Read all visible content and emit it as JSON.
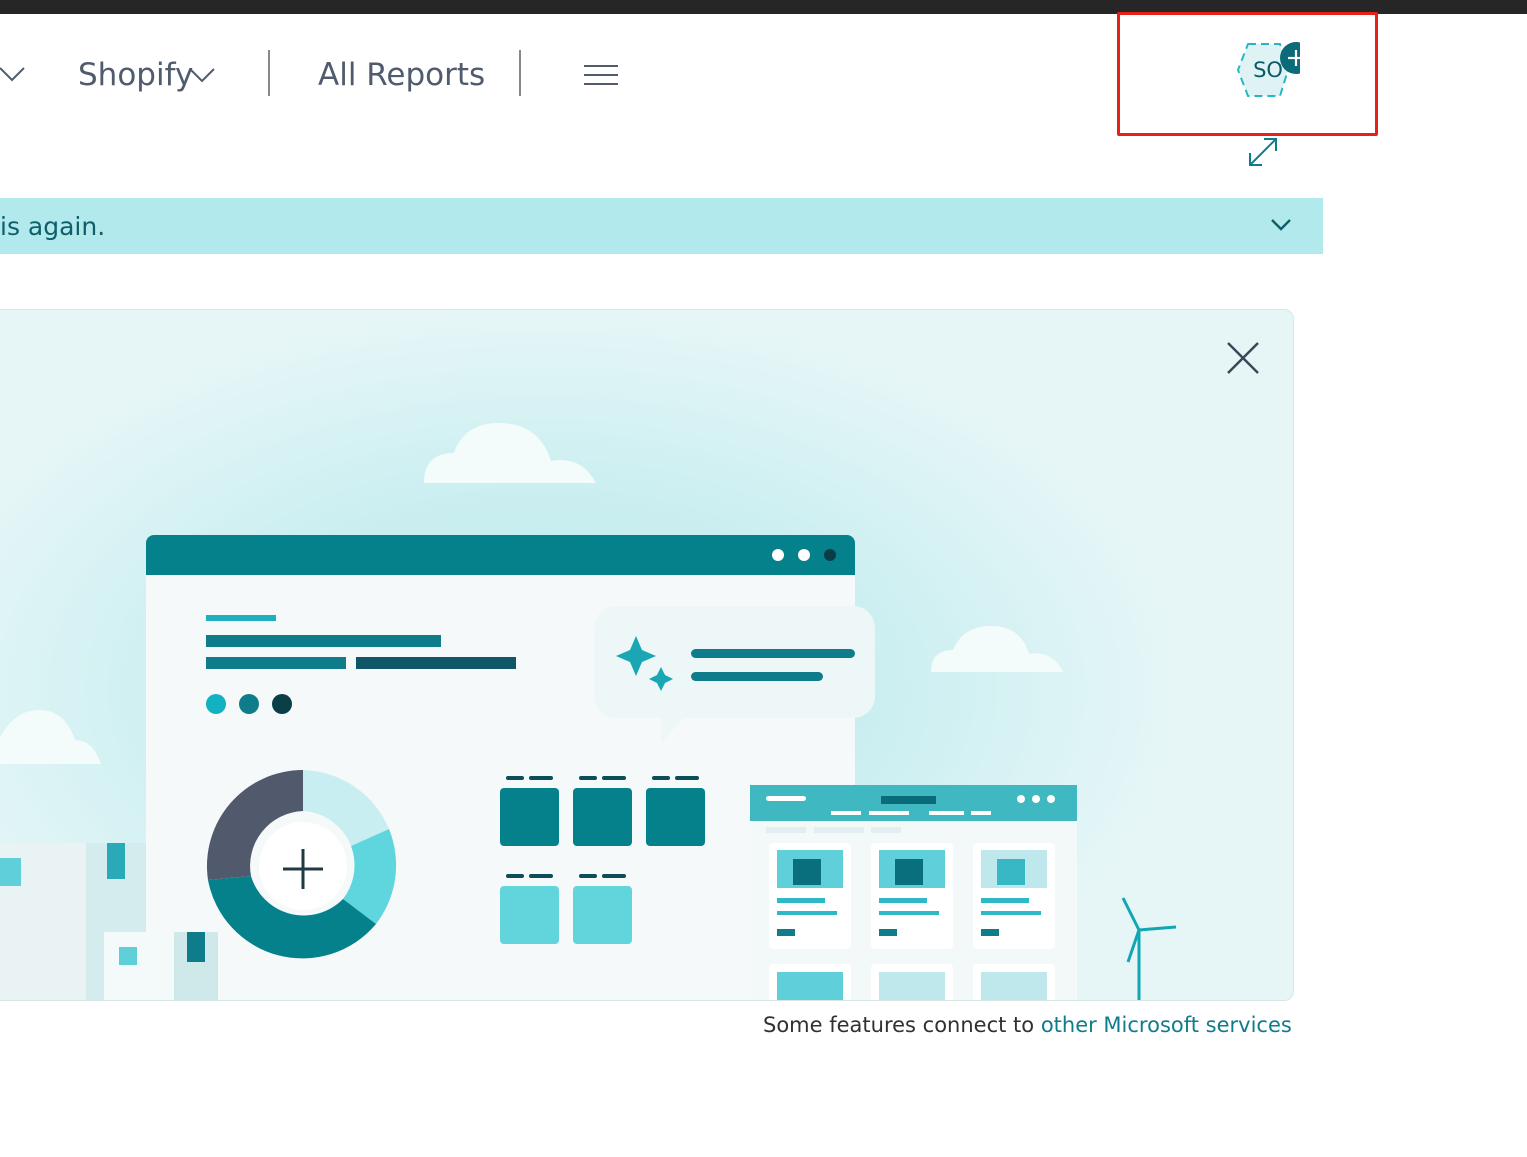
{
  "nav": {
    "shopify_label": "Shopify",
    "reports_label": "All Reports"
  },
  "profile": {
    "avatar_initials": "SO"
  },
  "banner": {
    "text": "is again."
  },
  "footer": {
    "prefix": "Some features connect to ",
    "link_text": "other Microsoft services"
  },
  "colors": {
    "accent": "#008591",
    "banner_bg": "#b2e9ec",
    "highlight": "#e8201a",
    "link": "#0f7c8c"
  },
  "icons": [
    "chevron-down-icon",
    "hamburger-menu-icon",
    "add-icon",
    "expand-icon",
    "close-icon"
  ]
}
